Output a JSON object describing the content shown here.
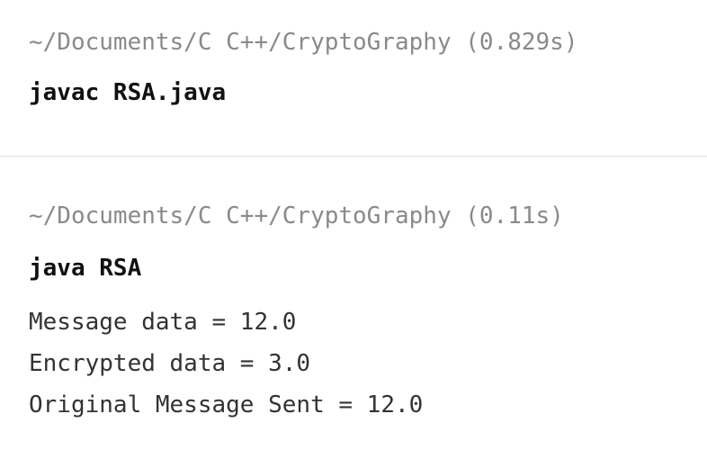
{
  "blocks": [
    {
      "prompt": "~/Documents/C C++/CryptoGraphy (0.829s)",
      "command": "javac RSA.java"
    },
    {
      "prompt": "~/Documents/C C++/CryptoGraphy (0.11s)",
      "command": "java RSA",
      "output": [
        "Message data = 12.0",
        "Encrypted data = 3.0",
        "Original Message Sent = 12.0"
      ]
    }
  ]
}
